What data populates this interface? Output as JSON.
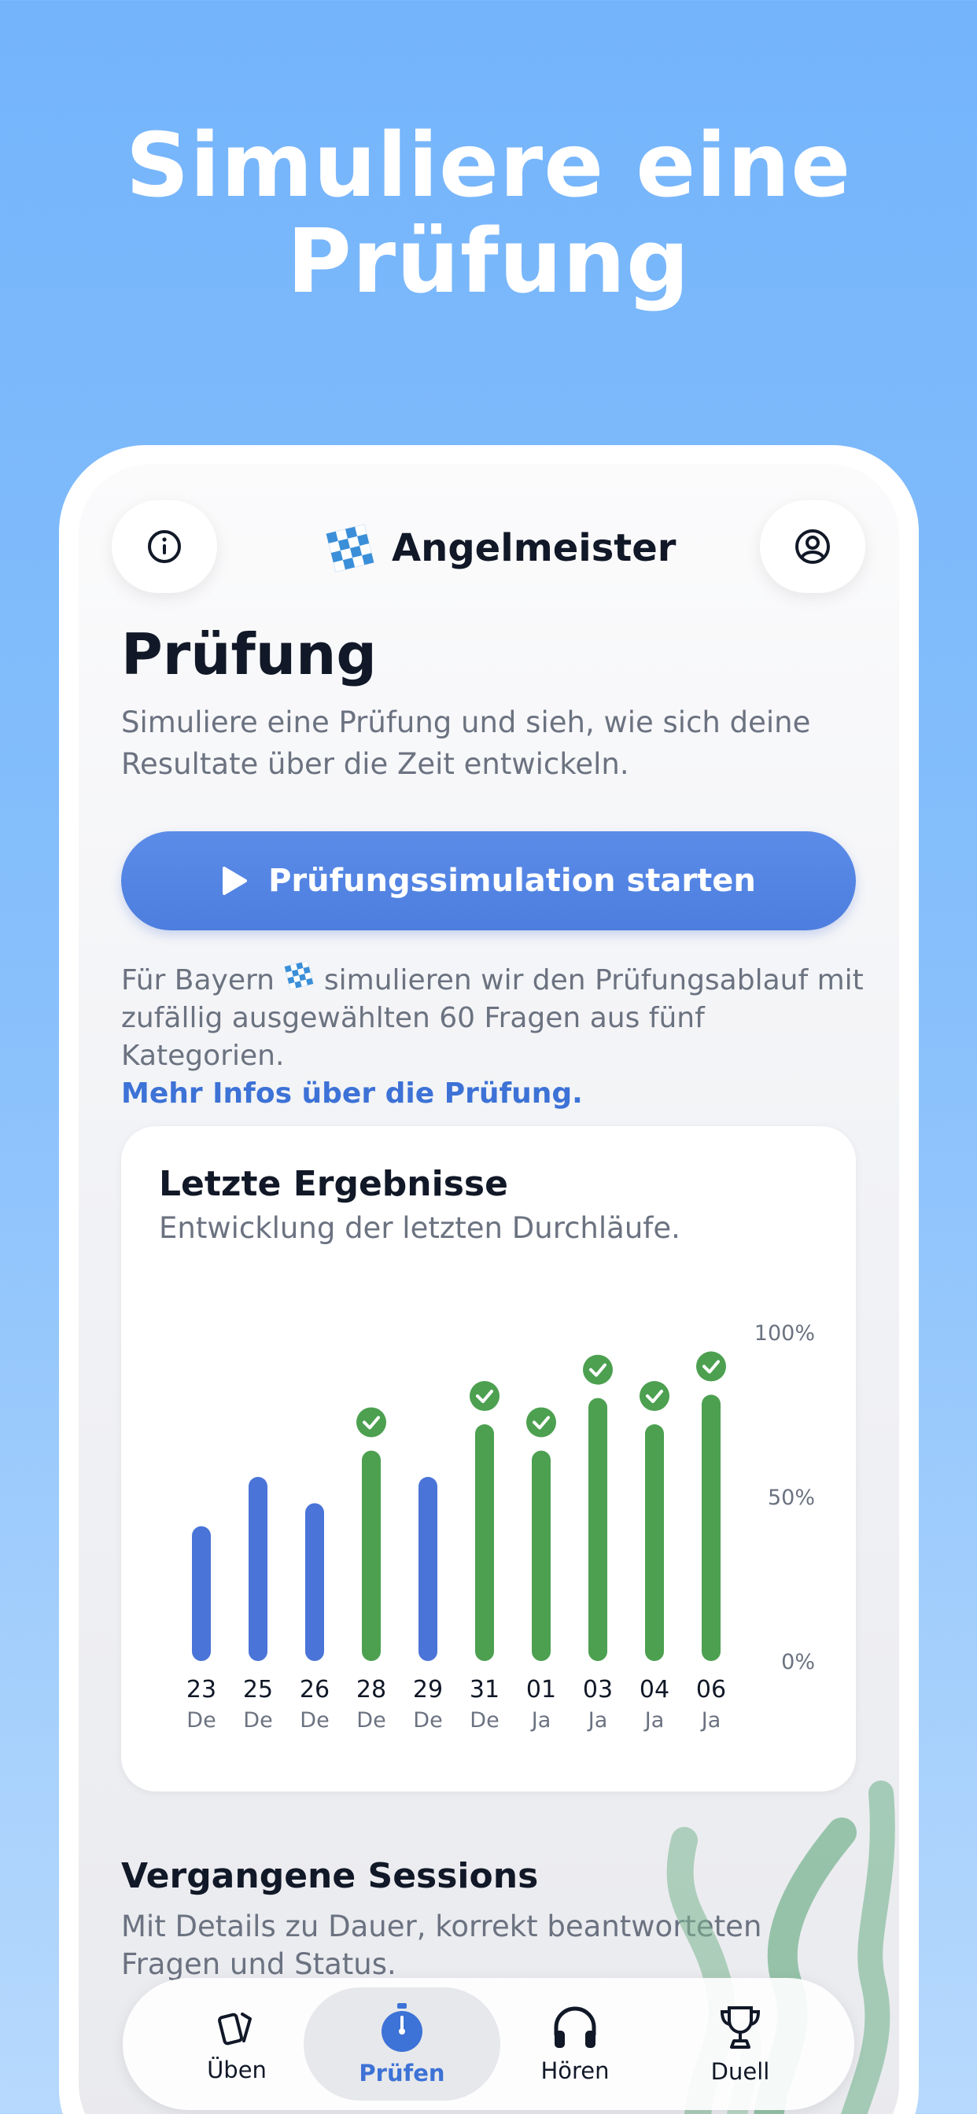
{
  "headline": {
    "line1": "Simuliere eine",
    "line2": "Prüfung"
  },
  "header": {
    "app_name": "Angelmeister",
    "info_icon": "info-icon",
    "profile_icon": "user-circle-icon"
  },
  "page": {
    "title": "Prüfung",
    "description": "Simuliere eine Prüfung und sieh, wie sich deine Resultate über die Zeit entwickeln.",
    "start_button": "Prüfungssimulation starten",
    "info_before": "Für Bayern",
    "info_after": "simulieren wir den Prüfungsablauf mit zufällig ausgewählten 60 Fragen aus fünf Kategorien.",
    "info_link": "Mehr Infos über die Prüfung."
  },
  "results_card": {
    "title": "Letzte Ergebnisse",
    "subtitle": "Entwicklung der letzten Durchläufe."
  },
  "chart_data": {
    "type": "bar",
    "categories": [
      "23 De",
      "25 De",
      "26 De",
      "28 De",
      "29 De",
      "31 De",
      "01 Ja",
      "03 Ja",
      "04 Ja",
      "06 Ja"
    ],
    "day_labels": [
      "23",
      "25",
      "26",
      "28",
      "29",
      "31",
      "01",
      "03",
      "04",
      "06"
    ],
    "month_labels": [
      "De",
      "De",
      "De",
      "De",
      "De",
      "De",
      "Ja",
      "Ja",
      "Ja",
      "Ja"
    ],
    "values": [
      41,
      56,
      48,
      64,
      56,
      72,
      64,
      80,
      72,
      81
    ],
    "passed": [
      false,
      false,
      false,
      true,
      false,
      true,
      true,
      true,
      true,
      true
    ],
    "ylim": [
      0,
      100
    ],
    "y_ticks": [
      "100%",
      "50%",
      "0%"
    ],
    "colors": {
      "failed": "#4a74d8",
      "passed": "#4ca050",
      "check": "#4ca050"
    }
  },
  "sessions": {
    "title": "Vergangene Sessions",
    "description": "Mit Details zu Dauer, korrekt beantworteten Fragen und Status."
  },
  "tabbar": {
    "tabs": [
      {
        "label": "Üben",
        "icon": "cards-icon",
        "active": false
      },
      {
        "label": "Prüfen",
        "icon": "stopwatch-icon",
        "active": true
      },
      {
        "label": "Hören",
        "icon": "headphones-icon",
        "active": false
      },
      {
        "label": "Duell",
        "icon": "trophy-icon",
        "active": false
      }
    ]
  }
}
